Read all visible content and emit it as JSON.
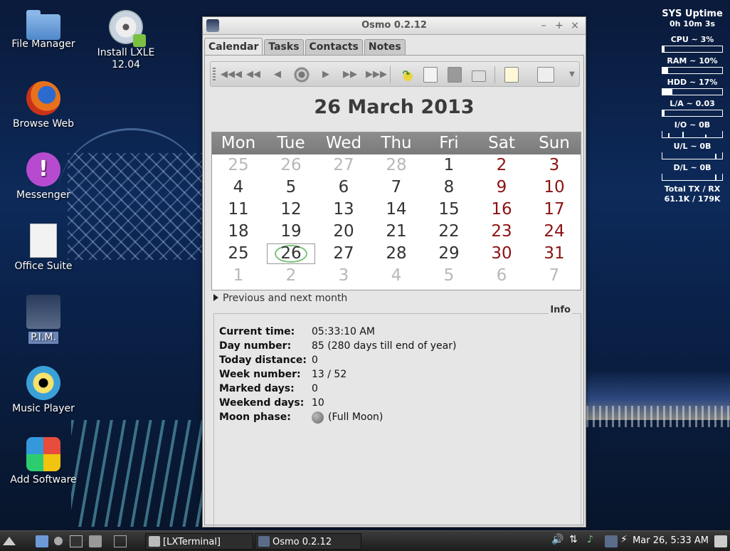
{
  "desktop": {
    "icons": [
      {
        "label": "File Manager"
      },
      {
        "label": "Install LXLE 12.04"
      },
      {
        "label": "Browse Web"
      },
      {
        "label": "Messenger"
      },
      {
        "label": "Office Suite"
      },
      {
        "label": "P.I.M."
      },
      {
        "label": "Music Player"
      },
      {
        "label": "Add Software"
      }
    ]
  },
  "window": {
    "title": "Osmo 0.2.12",
    "controls": {
      "minimize": "–",
      "maximize": "+",
      "close": "×"
    },
    "tabs": [
      "Calendar",
      "Tasks",
      "Contacts",
      "Notes"
    ],
    "active_tab": "Calendar",
    "toolbar": {
      "buttons": [
        "prev-year-icon",
        "prev-month-icon",
        "prev-day-icon",
        "today-icon",
        "next-day-icon",
        "next-month-icon",
        "next-year-icon",
        "jump-to-date-icon",
        "full-year-icon",
        "calculator-icon",
        "print-icon",
        "edit-note-icon",
        "preferences-icon",
        "dropdown-arrow-icon"
      ]
    },
    "date_title": "26 March 2013",
    "calendar": {
      "weekdays": [
        "Mon",
        "Tue",
        "Wed",
        "Thu",
        "Fri",
        "Sat",
        "Sun"
      ],
      "weeks": [
        [
          {
            "d": "25",
            "o": true
          },
          {
            "d": "26",
            "o": true
          },
          {
            "d": "27",
            "o": true
          },
          {
            "d": "28",
            "o": true
          },
          {
            "d": "1"
          },
          {
            "d": "2",
            "w": true
          },
          {
            "d": "3",
            "w": true
          }
        ],
        [
          {
            "d": "4"
          },
          {
            "d": "5"
          },
          {
            "d": "6"
          },
          {
            "d": "7"
          },
          {
            "d": "8"
          },
          {
            "d": "9",
            "w": true
          },
          {
            "d": "10",
            "w": true
          }
        ],
        [
          {
            "d": "11"
          },
          {
            "d": "12"
          },
          {
            "d": "13"
          },
          {
            "d": "14"
          },
          {
            "d": "15"
          },
          {
            "d": "16",
            "w": true
          },
          {
            "d": "17",
            "w": true
          }
        ],
        [
          {
            "d": "18"
          },
          {
            "d": "19"
          },
          {
            "d": "20"
          },
          {
            "d": "21"
          },
          {
            "d": "22"
          },
          {
            "d": "23",
            "w": true
          },
          {
            "d": "24",
            "w": true
          }
        ],
        [
          {
            "d": "25"
          },
          {
            "d": "26",
            "t": true
          },
          {
            "d": "27"
          },
          {
            "d": "28"
          },
          {
            "d": "29"
          },
          {
            "d": "30",
            "w": true
          },
          {
            "d": "31",
            "w": true
          }
        ],
        [
          {
            "d": "1",
            "o": true
          },
          {
            "d": "2",
            "o": true
          },
          {
            "d": "3",
            "o": true
          },
          {
            "d": "4",
            "o": true
          },
          {
            "d": "5",
            "o": true
          },
          {
            "d": "6",
            "o": true
          },
          {
            "d": "7",
            "o": true
          }
        ]
      ],
      "colors": {
        "weekend": "#8c1212",
        "other_month": "#b8b8b8",
        "today_ring": "#7ac27a"
      }
    },
    "expander_label": "Previous and next month",
    "info": {
      "label": "Info",
      "rows": [
        {
          "k": "Current time:",
          "v": "05:33:10 AM"
        },
        {
          "k": "Day number:",
          "v": "85 (280 days till end of year)"
        },
        {
          "k": "Today distance:",
          "v": "0"
        },
        {
          "k": "Week number:",
          "v": "13 / 52"
        },
        {
          "k": "Marked days:",
          "v": "0"
        },
        {
          "k": "Weekend days:",
          "v": "10"
        },
        {
          "k": "Moon phase:",
          "v": "(Full Moon)"
        }
      ]
    }
  },
  "conky": {
    "title": "SYS Uptime",
    "uptime": "0h 10m 3s",
    "cpu": {
      "label": "CPU ~ 3%",
      "pct": 3
    },
    "ram": {
      "label": "RAM ~ 10%",
      "pct": 10
    },
    "hdd": {
      "label": "HDD ~ 17%",
      "pct": 17
    },
    "la": {
      "label": "L/A ~ 0.03",
      "pct": 3
    },
    "io": "I/O ~   0B",
    "ul": "U/L ~   0B",
    "dl": "D/L ~   0B",
    "total_label": "Total TX / RX",
    "total_value": "61.1K / 179K"
  },
  "taskbar": {
    "tasks": [
      "[LXTerminal]",
      "Osmo 0.2.12"
    ],
    "clock": "Mar 26, 5:33 AM"
  }
}
